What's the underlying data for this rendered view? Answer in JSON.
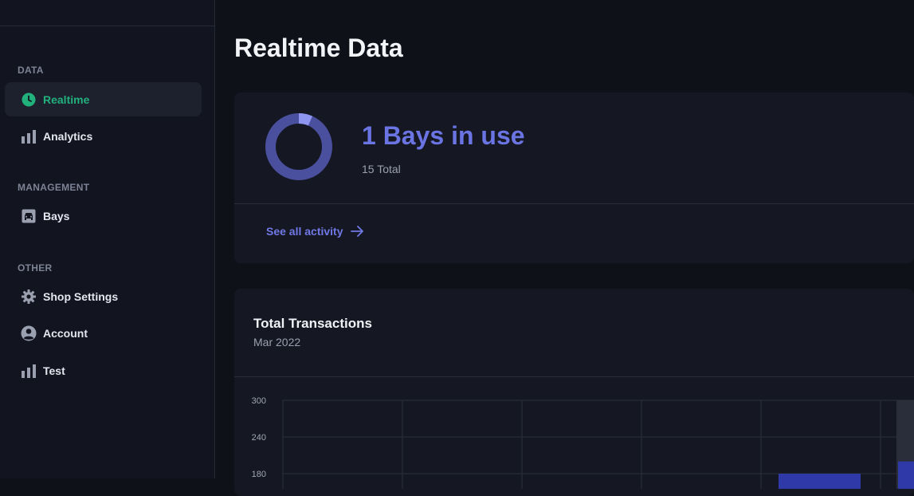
{
  "sidebar": {
    "sections": [
      {
        "label": "DATA"
      },
      {
        "label": "MANAGEMENT"
      },
      {
        "label": "OTHER"
      }
    ],
    "items": [
      {
        "label": "Realtime",
        "icon": "clock-icon",
        "active": true
      },
      {
        "label": "Analytics",
        "icon": "bar-chart-icon"
      },
      {
        "label": "Bays",
        "icon": "car-icon"
      },
      {
        "label": "Shop Settings",
        "icon": "gear-icon"
      },
      {
        "label": "Account",
        "icon": "user-circle-icon"
      },
      {
        "label": "Test",
        "icon": "bar-chart-icon"
      }
    ]
  },
  "main": {
    "title": "Realtime Data",
    "bays_card": {
      "headline": "1 Bays in use",
      "total": "15 Total",
      "in_use": 1,
      "capacity": 15,
      "link_label": "See all activity",
      "link_icon": "arrow-right-icon"
    },
    "transactions_card": {
      "title": "Total Transactions",
      "subtitle": "Mar 2022"
    }
  },
  "colors": {
    "accent": "#6b74e3",
    "active_nav": "#22b07d",
    "bar": "#2f3aa8"
  },
  "chart_data": {
    "type": "bar",
    "y_ticks": [
      "300",
      "240",
      "180"
    ],
    "ylim": [
      0,
      300
    ],
    "bars": [
      {
        "slot": 5,
        "value": 180
      },
      {
        "slot": 6,
        "value": 200
      }
    ]
  }
}
